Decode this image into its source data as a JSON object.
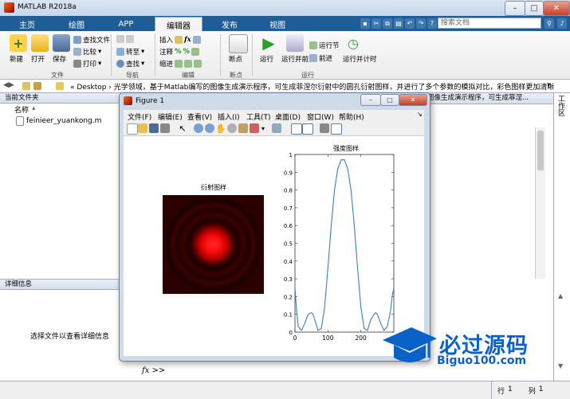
{
  "window": {
    "title": "MATLAB R2018a"
  },
  "tabs": [
    "主页",
    "绘图",
    "APP",
    "编辑器",
    "发布",
    "视图"
  ],
  "search": {
    "placeholder": "搜索文档"
  },
  "ribbon": {
    "file": {
      "new": "新建",
      "open": "打开",
      "save": "保存",
      "find_files": "查找文件",
      "compare": "比较",
      "print": "打印",
      "group": "文件"
    },
    "navigate": {
      "goto": "转至",
      "find": "查找",
      "group": "导航"
    },
    "edit": {
      "insert": "插入",
      "comment": "注释",
      "indent": "缩进",
      "group": "编辑"
    },
    "breakpoints": {
      "label": "断点",
      "group": "断点"
    },
    "run": {
      "run": "运行",
      "run_advance": "运行并前进",
      "run_section": "运行节",
      "advance": "前进",
      "run_time": "运行并计时",
      "group": "运行"
    }
  },
  "address": {
    "path": "« Desktop › 光学领域，基于Matlab编写的图像生成演示程序，可生成菲涅尔衍射中的圆孔衍射图样，并进行了多个参数的模拟对比，彩色图样更加清晰"
  },
  "current_folder": {
    "title": "当前文件夹",
    "col_name": "名称",
    "files": [
      "feinieer_yuankong.m"
    ]
  },
  "editor_tab_text": "图像生成演示程序，可生成菲涅...",
  "details": {
    "title": "详细信息",
    "empty_msg": "选择文件以查看详细信息"
  },
  "command": {
    "prompt": "fx >>"
  },
  "status": {
    "row_label": "行",
    "row_val": "1",
    "col_label": "列",
    "col_val": "1"
  },
  "figure": {
    "title": "Figure 1",
    "menu": [
      "文件(F)",
      "编辑(E)",
      "查看(V)",
      "插入(I)",
      "工具(T)",
      "桌面(D)",
      "窗口(W)",
      "帮助(H)"
    ],
    "left_plot_title": "衍射图样",
    "right_plot_title": "强度图样"
  },
  "chart_data": {
    "type": "line",
    "title": "强度图样",
    "xlim": [
      0,
      300
    ],
    "ylim": [
      0,
      1
    ],
    "xticks": [
      0,
      100,
      200
    ],
    "yticks": [
      0,
      0.1,
      0.2,
      0.3,
      0.4,
      0.5,
      0.6,
      0.7,
      0.8,
      0.9,
      1
    ],
    "x": [
      0,
      5,
      10,
      20,
      30,
      40,
      50,
      55,
      60,
      70,
      80,
      90,
      100,
      110,
      120,
      130,
      140,
      150,
      160,
      170,
      180,
      190,
      200,
      210,
      220,
      230,
      240,
      245,
      250,
      260,
      270,
      280,
      290,
      295,
      300
    ],
    "y": [
      0.25,
      0.12,
      0.03,
      0.01,
      0.05,
      0.1,
      0.11,
      0.1,
      0.07,
      0.01,
      0.02,
      0.14,
      0.36,
      0.6,
      0.8,
      0.92,
      0.97,
      0.97,
      0.92,
      0.8,
      0.6,
      0.36,
      0.14,
      0.02,
      0.01,
      0.07,
      0.1,
      0.11,
      0.1,
      0.05,
      0.01,
      0.03,
      0.12,
      0.2,
      0.25
    ],
    "line_color": "#3a7fc1"
  },
  "watermark": {
    "text": "必过源码",
    "url": "Biguo100.com"
  },
  "colors": {
    "tab_bar": "#1f5d97",
    "accent": "#0a62c9"
  }
}
